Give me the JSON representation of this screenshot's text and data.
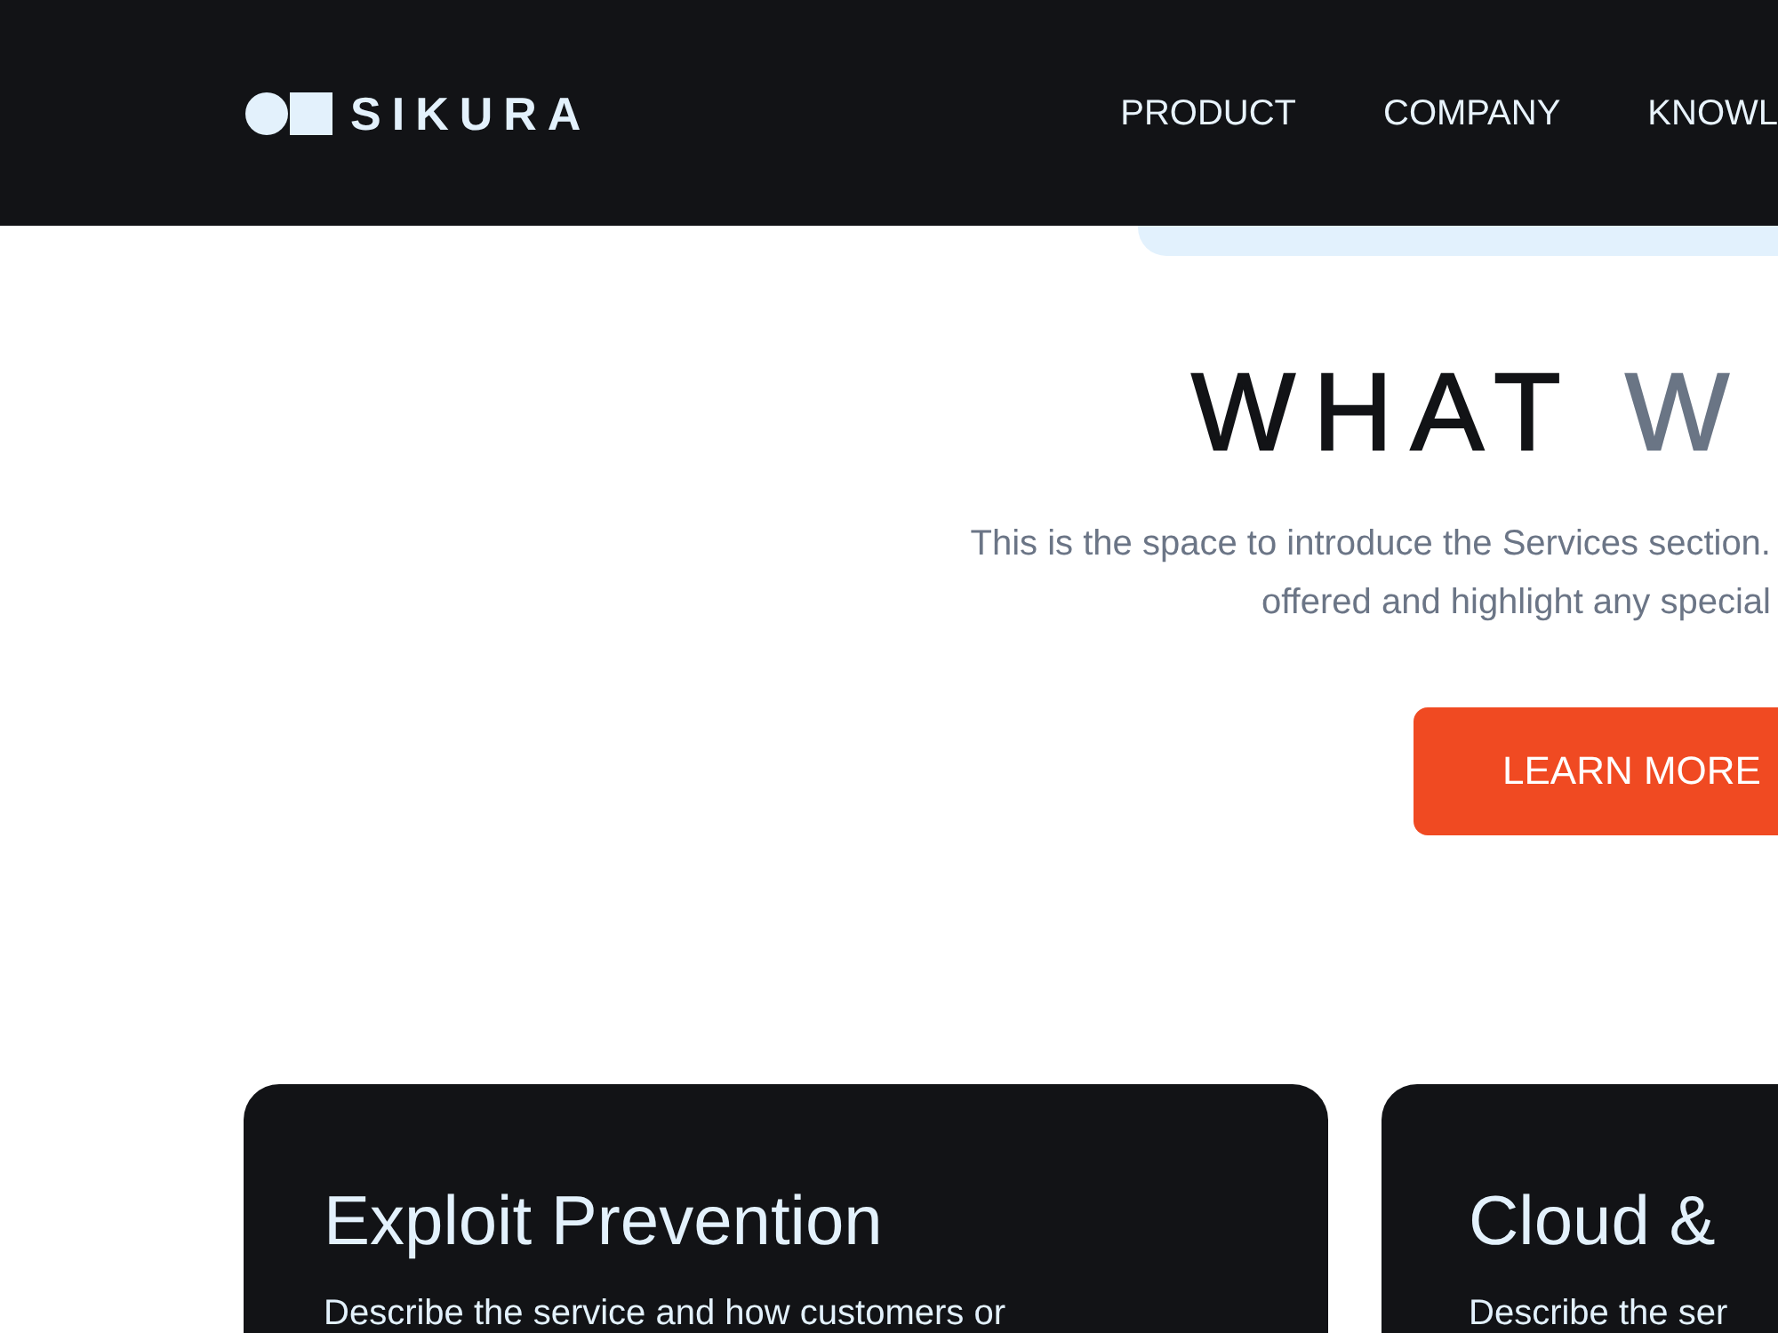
{
  "header": {
    "brand": "SIKURA",
    "nav": [
      "PRODUCT",
      "COMPANY",
      "KNOWL"
    ]
  },
  "services": {
    "heading": {
      "main": "WHAT",
      "accent": "W"
    },
    "intro_lines": [
      "This is the space to introduce the Services section.",
      "offered and highlight any special"
    ],
    "button": "LEARN MORE"
  },
  "cards": [
    {
      "title": "Exploit Prevention",
      "description": "Describe the service and how customers or"
    },
    {
      "title": "Cloud &",
      "description": "Describe the ser"
    }
  ]
}
